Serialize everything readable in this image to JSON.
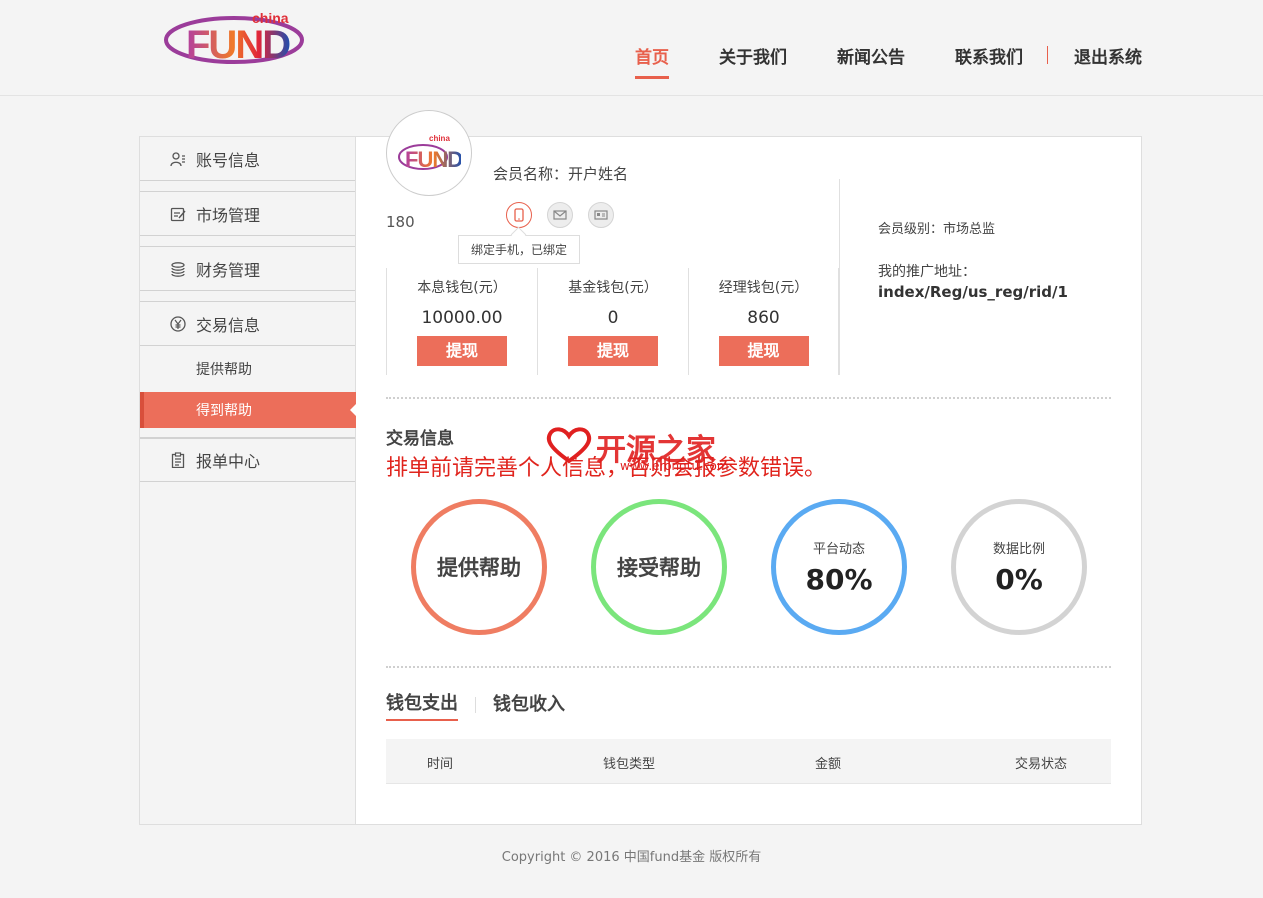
{
  "header": {
    "logo": {
      "top_text": "china",
      "main_text": "FUND"
    },
    "nav": [
      {
        "label": "首页",
        "active": true
      },
      {
        "label": "关于我们",
        "active": false
      },
      {
        "label": "新闻公告",
        "active": false
      },
      {
        "label": "联系我们",
        "active": false
      },
      {
        "label": "退出系统",
        "active": false
      }
    ]
  },
  "sidebar": {
    "items": [
      {
        "label": "账号信息",
        "icon": "user-icon"
      },
      {
        "label": "市场管理",
        "icon": "edit-icon"
      },
      {
        "label": "财务管理",
        "icon": "coins-icon"
      },
      {
        "label": "交易信息",
        "icon": "yen-icon"
      }
    ],
    "sub_items": [
      {
        "label": "提供帮助",
        "active": false
      },
      {
        "label": "得到帮助",
        "active": true
      }
    ],
    "last_item": {
      "label": "报单中心",
      "icon": "clipboard-icon"
    }
  },
  "profile": {
    "member_name": "会员名称：开户姓名",
    "user_id": "180",
    "bind_tooltip": "绑定手机，已绑定",
    "level": "会员级别：市场总监",
    "promo_label": "我的推广地址：",
    "promo_url": "index/Reg/us_reg/rid/1"
  },
  "wallets": [
    {
      "label": "本息钱包(元）",
      "value": "10000.00",
      "button": "提现"
    },
    {
      "label": "基金钱包(元）",
      "value": "0",
      "button": "提现"
    },
    {
      "label": "经理钱包(元）",
      "value": "860",
      "button": "提现"
    }
  ],
  "trade": {
    "title": "交易信息",
    "notice": "排单前请完善个人信息，否则会报参数错误。",
    "watermark": "开源之家",
    "watermark_url": "www.erongtu.com"
  },
  "circles": [
    {
      "label": "提供帮助",
      "color": "#ef7d62"
    },
    {
      "label": "接受帮助",
      "color": "#7be57c"
    },
    {
      "label": "平台动态",
      "value": "80%",
      "color": "#5aaaf2"
    },
    {
      "label": "数据比例",
      "value": "0%",
      "color": "#d3d3d3"
    }
  ],
  "tabs": [
    {
      "label": "钱包支出",
      "active": true
    },
    {
      "label": "钱包收入",
      "active": false
    }
  ],
  "table": {
    "columns": [
      "时间",
      "钱包类型",
      "金额",
      "交易状态"
    ]
  },
  "footer": {
    "copyright": "Copyright © 2016 中国fund基金 版权所有"
  },
  "colors": {
    "accent": "#e8604c",
    "button": "#ec6e5a"
  }
}
